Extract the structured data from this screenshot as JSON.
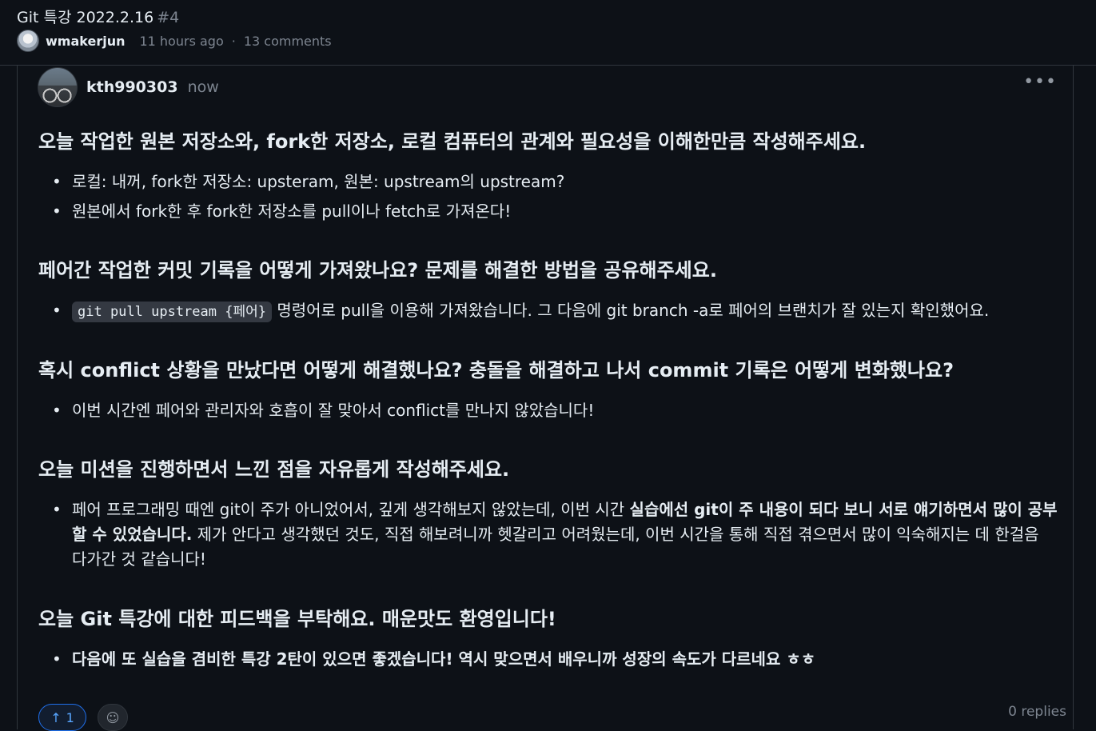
{
  "discussion": {
    "title": "Git 특강 2022.2.16",
    "number": "#4",
    "author": "wmakerjun",
    "age": "11 hours ago",
    "separator": "·",
    "comments": "13 comments"
  },
  "comment": {
    "login": "kth990303",
    "time": "now",
    "more_icon": "kebab-horizontal-icon",
    "sections": [
      {
        "heading": "오늘 작업한 원본 저장소와, fork한 저장소, 로컬 컴퓨터의 관계와 필요성을 이해한만큼 작성해주세요.",
        "items": [
          "로컬: 내꺼, fork한 저장소: upsteram, 원본: upstream의 upstream?",
          "원본에서 fork한 후 fork한 저장소를 pull이나 fetch로 가져온다!"
        ]
      },
      {
        "heading": "페어간 작업한 커밋 기록을 어떻게 가져왔나요? 문제를 해결한 방법을 공유해주세요.",
        "code": "git pull upstream {페어}",
        "item_after_code": "명령어로 pull을 이용해 가져왔습니다. 그 다음에 git branch -a로 페어의 브랜치가 잘 있는지 확인했어요."
      },
      {
        "heading": "혹시 conflict 상황을 만났다면 어떻게 해결했나요? 충돌을 해결하고 나서 commit 기록은 어떻게 변화했나요?",
        "items": [
          "이번 시간엔 페어와 관리자와 호흡이 잘 맞아서 conflict를 만나지 않았습니다!"
        ]
      },
      {
        "heading": "오늘 미션을 진행하면서 느낀 점을 자유롭게 작성해주세요.",
        "p1": "페어 프로그래밍 때엔 git이 주가 아니었어서, 깊게 생각해보지 않았는데, 이번 시간 ",
        "p1_bold": "실습에선 git이 주 내용이 되다 보니 서로 얘기하면서 많이 공부할 수 있었습니다.",
        "p1_rest": " 제가 안다고 생각했던 것도, 직접 해보려니까 헷갈리고 어려웠는데, 이번 시간을 통해 직접 겪으면서 많이 익숙해지는 데 한걸음 다가간 것 같습니다!"
      },
      {
        "heading": "오늘 Git 특강에 대한 피드백을 부탁해요. 매운맛도 환영입니다!",
        "items": [
          "다음에 또 실습을 겸비한 특강 2탄이 있으면 좋겠습니다! 역시 맞으면서 배우니까 성장의 속도가 다르네요 ㅎㅎ"
        ]
      }
    ],
    "upvote": {
      "icon": "arrow-up-icon",
      "count": "1"
    },
    "emoji_icon": "smiley-icon",
    "replies": "0 replies"
  }
}
